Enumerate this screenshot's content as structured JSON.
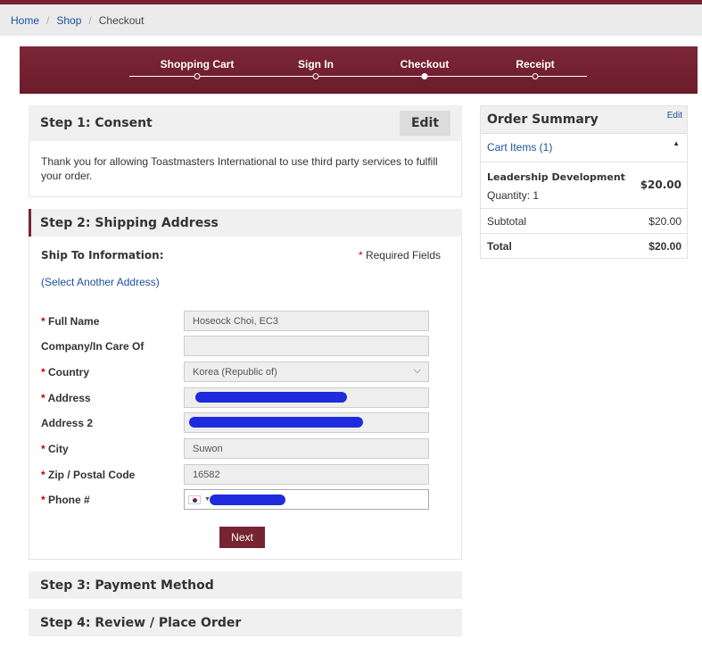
{
  "breadcrumb": {
    "home": "Home",
    "shop": "Shop",
    "current": "Checkout",
    "separator": "/"
  },
  "progress": {
    "steps": [
      "Shopping Cart",
      "Sign In",
      "Checkout",
      "Receipt"
    ],
    "active_step": "Checkout"
  },
  "consent": {
    "title": "Step 1: Consent",
    "edit_label": "Edit",
    "message": "Thank you for allowing Toastmasters International to use third party services to fulfill your order."
  },
  "shipping": {
    "title": "Step 2: Shipping Address",
    "ship_to_label": "Ship To Information:",
    "required_note": "Required Fields",
    "required_star": "*",
    "select_address_link": "(Select Another Address)",
    "fields": {
      "full_name": {
        "label": "Full Name",
        "value": "Hoseock Choi, EC3"
      },
      "company": {
        "label": "Company/In Care Of",
        "value": ""
      },
      "country": {
        "label": "Country",
        "value": "Korea (Republic of)"
      },
      "address": {
        "label": "Address",
        "value": ""
      },
      "address2": {
        "label": "Address 2",
        "value": ""
      },
      "city": {
        "label": "City",
        "value": "Suwon"
      },
      "zip": {
        "label": "Zip / Postal Code",
        "value": "16582"
      },
      "phone": {
        "label": "Phone #",
        "value": ""
      }
    },
    "next_label": "Next"
  },
  "payment": {
    "title": "Step 3: Payment Method"
  },
  "review": {
    "title": "Step 4: Review / Place Order"
  },
  "summary": {
    "title": "Order Summary",
    "edit_label": "Edit",
    "cart_items_label": "Cart Items (1)",
    "items": [
      {
        "name": "Leadership Development",
        "quantity": "Quantity: 1",
        "price": "$20.00"
      }
    ],
    "subtotal_label": "Subtotal",
    "subtotal_value": "$20.00",
    "total_label": "Total",
    "total_value": "$20.00"
  },
  "colors": {
    "brand": "#772432",
    "link": "#1a4f9c",
    "redaction": "#1f2bdc"
  }
}
